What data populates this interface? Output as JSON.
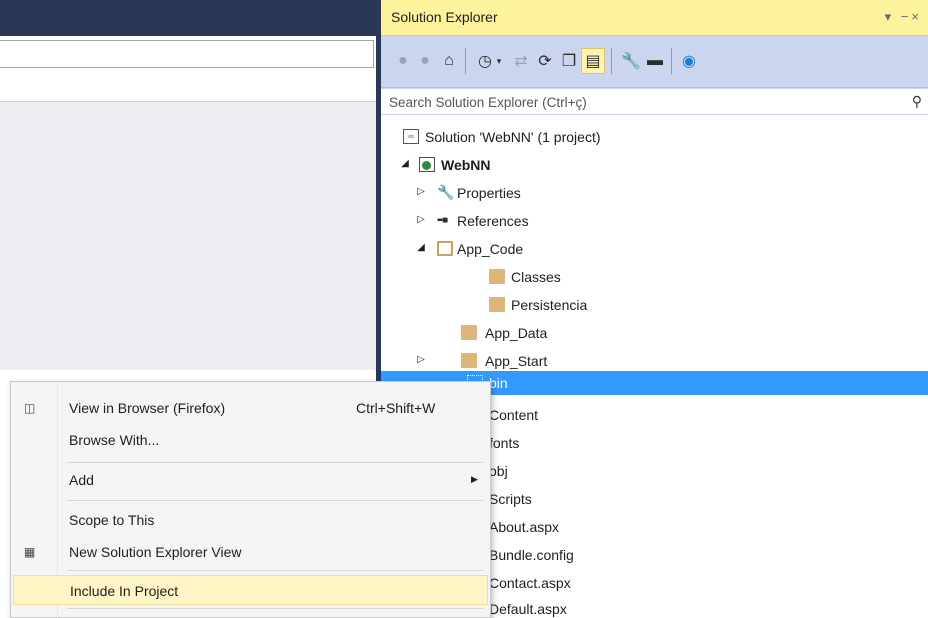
{
  "solution_explorer": {
    "title": "Solution Explorer",
    "window_controls": "▾ −×",
    "search_placeholder": "Search Solution Explorer (Ctrl+ç)",
    "toolbar": {
      "icons": [
        "back-icon",
        "forward-icon",
        "home-icon",
        "history-icon",
        "sync-icon",
        "refresh-icon",
        "collapse-all-icon",
        "show-all-files-icon",
        "properties-icon",
        "preview-icon",
        "browser-link-icon"
      ]
    },
    "tree": [
      {
        "label": "Solution 'WebNN' (1 project)",
        "bold": false
      },
      {
        "label": "WebNN",
        "bold": true
      },
      {
        "label": "Properties",
        "bold": false
      },
      {
        "label": "References",
        "bold": false
      },
      {
        "label": "App_Code",
        "bold": false
      },
      {
        "label": "Classes",
        "bold": false
      },
      {
        "label": "Persistencia",
        "bold": false
      },
      {
        "label": "App_Data",
        "bold": false
      },
      {
        "label": "App_Start",
        "bold": false
      },
      {
        "label": "bin",
        "bold": false,
        "selected": true
      },
      {
        "label": "Content",
        "bold": false
      },
      {
        "label": "fonts",
        "bold": false
      },
      {
        "label": "obj",
        "bold": false
      },
      {
        "label": "Scripts",
        "bold": false
      },
      {
        "label": "About.aspx",
        "bold": false
      },
      {
        "label": "Bundle.config",
        "bold": false
      },
      {
        "label": "Contact.aspx",
        "bold": false
      },
      {
        "label": "Default.aspx",
        "bold": false
      }
    ]
  },
  "context_menu": {
    "items": [
      {
        "label": "View in Browser (Firefox)",
        "shortcut": "Ctrl+Shift+W"
      },
      {
        "label": "Browse With..."
      },
      {
        "label": "Add"
      },
      {
        "label": "Scope to This"
      },
      {
        "label": "New Solution Explorer View"
      },
      {
        "label": "Include In Project",
        "highlighted": true
      }
    ]
  },
  "colors": {
    "titlebar_dark": "#293955",
    "se_title_bg": "#fff29d",
    "se_toolbar_bg": "#ccd5f0",
    "selection": "#3399ff",
    "menu_highlight": "#fff5c6"
  }
}
